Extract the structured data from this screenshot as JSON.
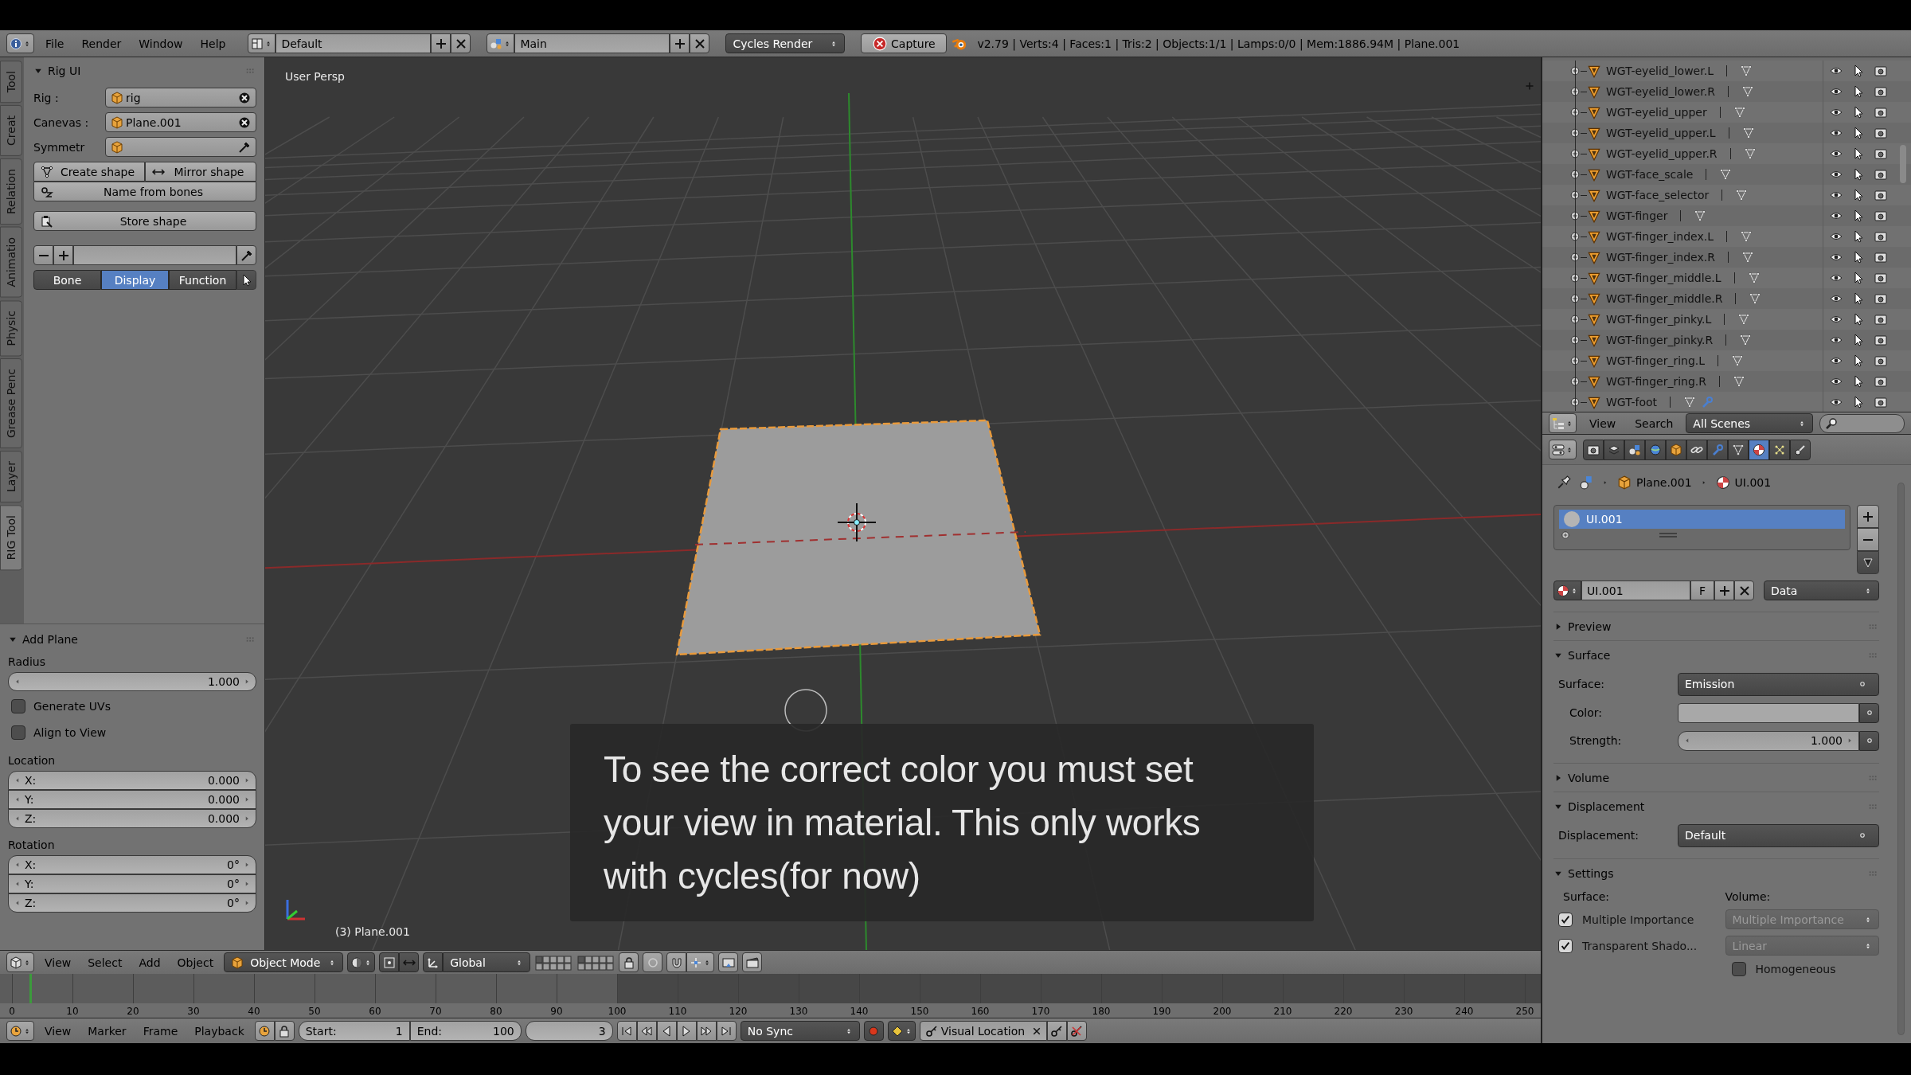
{
  "top_bar": {
    "menus": [
      "File",
      "Render",
      "Window",
      "Help"
    ],
    "layout": "Default",
    "scene": "Main",
    "engine": "Cycles Render",
    "capture": "Capture",
    "stats": "v2.79 | Verts:4 | Faces:1 | Tris:2 | Objects:1/1 | Lamps:0/0 | Mem:1886.94M | Plane.001"
  },
  "tool_shelf": {
    "tabs": [
      {
        "label": "Tool",
        "selected": false
      },
      {
        "label": "Creat",
        "selected": false
      },
      {
        "label": "Relation",
        "selected": false
      },
      {
        "label": "Animatio",
        "selected": false
      },
      {
        "label": "Physic",
        "selected": false
      },
      {
        "label": "Grease Penc",
        "selected": false
      },
      {
        "label": "Layer",
        "selected": false
      },
      {
        "label": "RIG Tool",
        "selected": true
      }
    ],
    "panel": {
      "title": "Rig UI",
      "expanded": true,
      "fields": [
        {
          "label": "Rig :",
          "value": "rig",
          "kind": "clear"
        },
        {
          "label": "Canevas :",
          "value": "Plane.001",
          "kind": "clear"
        },
        {
          "label": "Symmetr",
          "kind": "picker"
        }
      ],
      "buttons": [
        {
          "label": "Create shape",
          "kind": "create"
        },
        {
          "label": "Mirror shape",
          "kind": "mirror"
        },
        {
          "label": "Name from bones",
          "kind": "name"
        },
        {
          "label": "Store shape",
          "kind": "store"
        }
      ],
      "modes": [
        {
          "label": "Bone",
          "selected": false
        },
        {
          "label": "Display",
          "selected": true
        },
        {
          "label": "Function",
          "selected": false
        }
      ]
    }
  },
  "operator": {
    "title": "Add Plane",
    "expanded": true,
    "radius_label": "Radius",
    "radius": "1.000",
    "options": [
      {
        "label": "Generate UVs",
        "checked": false
      },
      {
        "label": "Align to View",
        "checked": false
      }
    ],
    "groups": [
      {
        "label": "Location",
        "fields": [
          {
            "axis": "X:",
            "value": "0.000"
          },
          {
            "axis": "Y:",
            "value": "0.000"
          },
          {
            "axis": "Z:",
            "value": "0.000"
          }
        ]
      },
      {
        "label": "Rotation",
        "fields": [
          {
            "axis": "X:",
            "value": "0°"
          },
          {
            "axis": "Y:",
            "value": "0°"
          },
          {
            "axis": "Z:",
            "value": "0°"
          }
        ]
      }
    ]
  },
  "viewport": {
    "view": "User Persp",
    "object": "(3) Plane.001",
    "caption": "To see the correct color you must set your view in material. This only works with cycles(for now)"
  },
  "view3d_header": {
    "menus": [
      "View",
      "Select",
      "Add",
      "Object"
    ],
    "mode": "Object Mode",
    "orientation": "Global"
  },
  "timeline": {
    "ticks": [
      "0",
      "10",
      "20",
      "30",
      "40",
      "50",
      "60",
      "70",
      "80",
      "90",
      "100",
      "110",
      "120",
      "130",
      "140",
      "150",
      "160",
      "170",
      "180",
      "190",
      "200",
      "210",
      "220",
      "230",
      "240",
      "250"
    ]
  },
  "timeline_header": {
    "menus": [
      "View",
      "Marker",
      "Frame",
      "Playback"
    ],
    "start_label": "Start:",
    "start": "1",
    "end_label": "End:",
    "end": "100",
    "current": "3",
    "sync": "No Sync",
    "keying_set": "Visual Location"
  },
  "outliner": {
    "rows": [
      {
        "name": "WGT-eyelid_lower.L",
        "modifier": false
      },
      {
        "name": "WGT-eyelid_lower.R",
        "modifier": false
      },
      {
        "name": "WGT-eyelid_upper",
        "modifier": false
      },
      {
        "name": "WGT-eyelid_upper.L",
        "modifier": false
      },
      {
        "name": "WGT-eyelid_upper.R",
        "modifier": false
      },
      {
        "name": "WGT-face_scale",
        "modifier": false
      },
      {
        "name": "WGT-face_selector",
        "modifier": false
      },
      {
        "name": "WGT-finger",
        "modifier": false
      },
      {
        "name": "WGT-finger_index.L",
        "modifier": false
      },
      {
        "name": "WGT-finger_index.R",
        "modifier": false
      },
      {
        "name": "WGT-finger_middle.L",
        "modifier": false
      },
      {
        "name": "WGT-finger_middle.R",
        "modifier": false
      },
      {
        "name": "WGT-finger_pinky.L",
        "modifier": false
      },
      {
        "name": "WGT-finger_pinky.R",
        "modifier": false
      },
      {
        "name": "WGT-finger_ring.L",
        "modifier": false
      },
      {
        "name": "WGT-finger_ring.R",
        "modifier": false
      },
      {
        "name": "WGT-foot",
        "modifier": true
      }
    ]
  },
  "outliner_header": {
    "menus": [
      "View",
      "Search"
    ],
    "filter": "All Scenes"
  },
  "properties": {
    "tabs": [
      {
        "kind": "render",
        "selected": false
      },
      {
        "kind": "layers",
        "selected": false
      },
      {
        "kind": "scene",
        "selected": false
      },
      {
        "kind": "world",
        "selected": false
      },
      {
        "kind": "object",
        "selected": false
      },
      {
        "kind": "constraints",
        "selected": false
      },
      {
        "kind": "modifiers",
        "selected": false
      },
      {
        "kind": "data",
        "selected": false
      },
      {
        "kind": "material",
        "selected": true
      },
      {
        "kind": "particles",
        "selected": false
      },
      {
        "kind": "physics",
        "selected": false
      }
    ],
    "path": [
      {
        "kind": "object",
        "label": "Plane.001"
      },
      {
        "kind": "material",
        "label": "UI.001"
      }
    ],
    "slots": [
      {
        "name": "UI.001",
        "selected": true
      }
    ],
    "material": {
      "name": "UI.001",
      "fake_user": "F",
      "link": "Data"
    },
    "panels": [
      {
        "title": "Preview",
        "expanded": false
      },
      {
        "title": "Surface",
        "expanded": true,
        "rows": [
          {
            "kind": "dropdown",
            "label": "Surface:",
            "value": "Emission"
          },
          {
            "kind": "color",
            "label": "Color:"
          },
          {
            "kind": "number",
            "label": "Strength:",
            "value": "1.000"
          }
        ]
      },
      {
        "title": "Volume",
        "expanded": false
      },
      {
        "title": "Displacement",
        "expanded": true,
        "rows": [
          {
            "kind": "dropdown",
            "label": "Displacement:",
            "value": "Default"
          }
        ]
      },
      {
        "title": "Settings",
        "expanded": true,
        "rows": [
          {
            "kind": "headings",
            "left": "Surface:",
            "right": "Volume:"
          },
          {
            "kind": "check_select",
            "label": "Multiple Importance",
            "checked": true,
            "value": "Multiple Importance",
            "disabled": true
          },
          {
            "kind": "check_select",
            "label": "Transparent Shado...",
            "checked": true,
            "value": "Linear",
            "disabled": true
          },
          {
            "kind": "check_right",
            "label": "Homogeneous",
            "checked": false
          }
        ]
      }
    ]
  }
}
